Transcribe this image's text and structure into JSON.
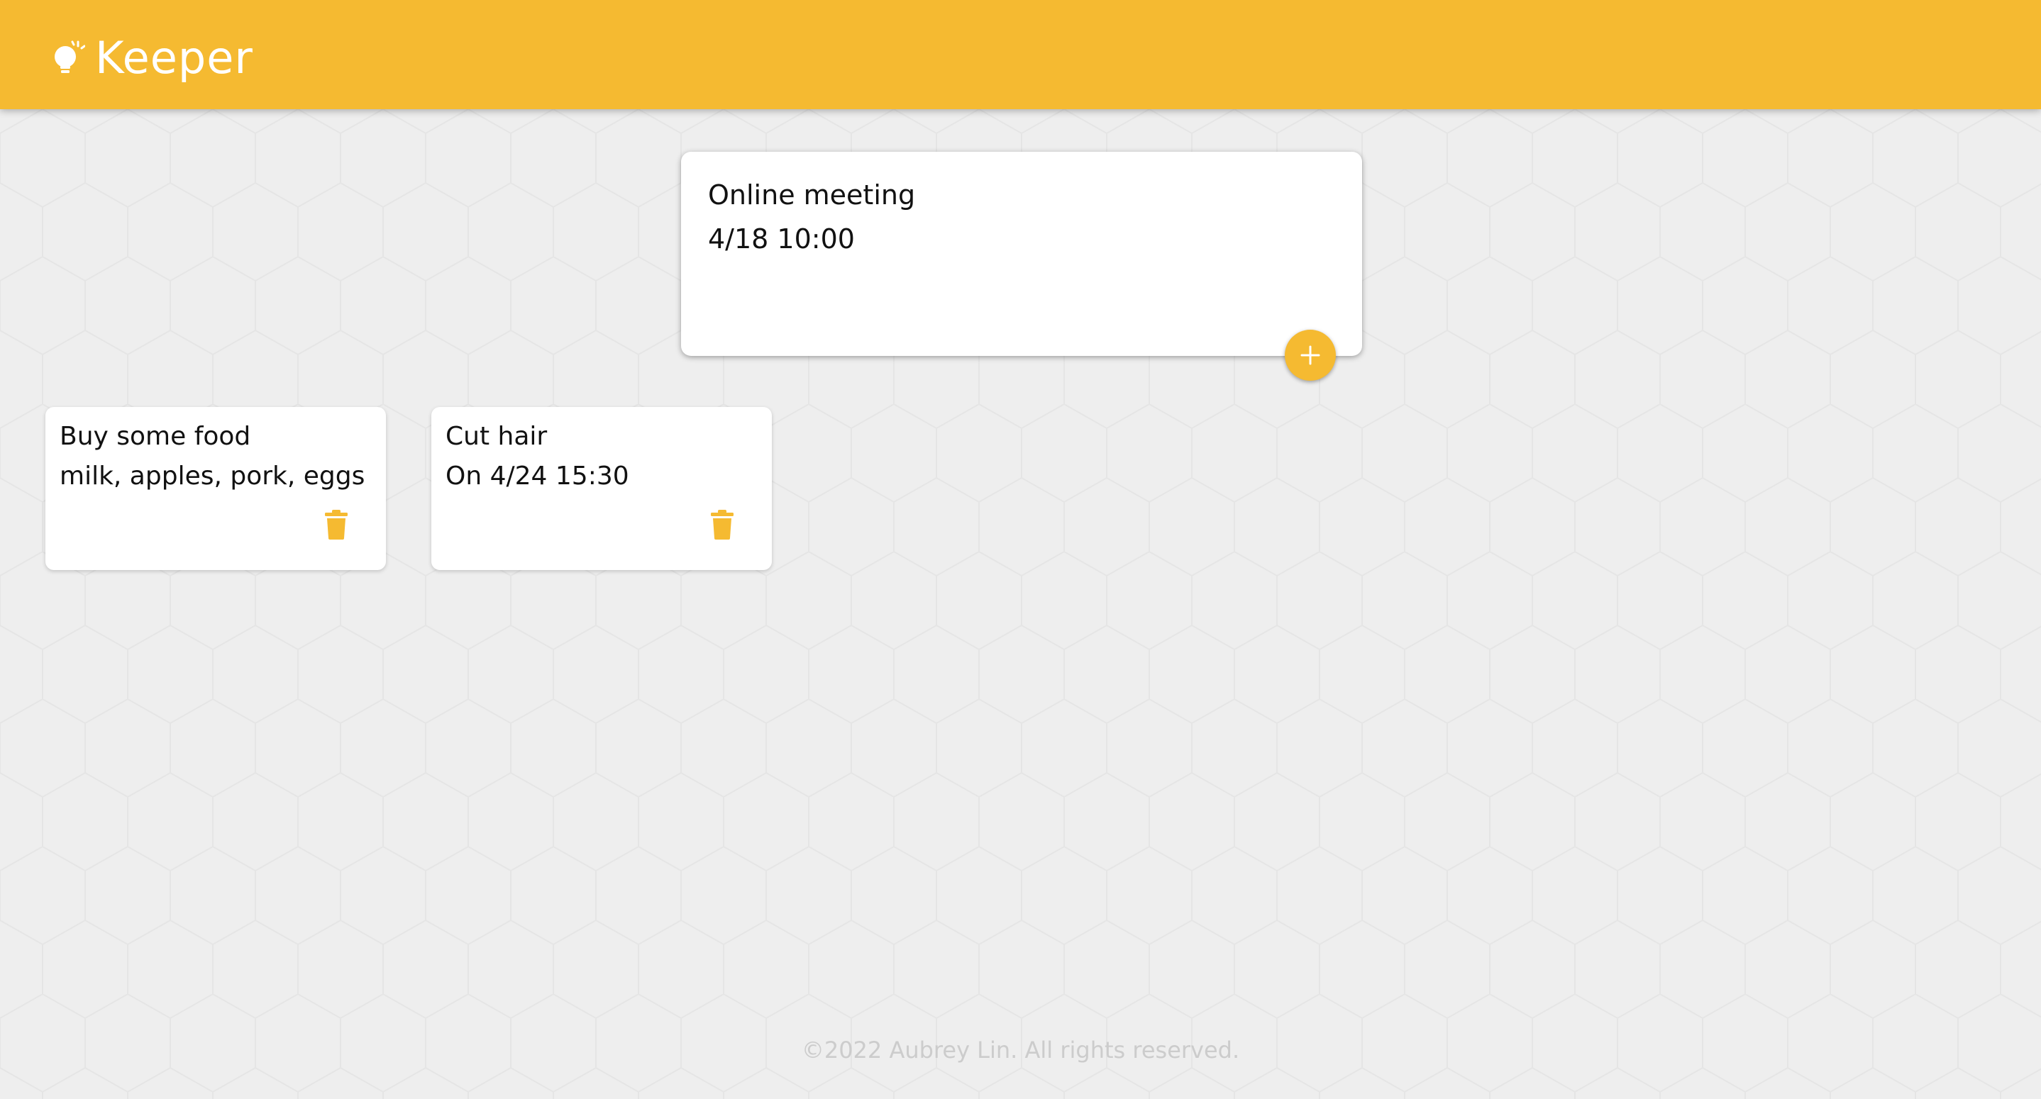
{
  "app": {
    "name": "Keeper",
    "accent_color": "#f5ba31",
    "background_color": "#eeeeee",
    "logo_icon": "lightbulb-icon"
  },
  "create_area": {
    "title": "Online meeting",
    "content": "4/18 10:00",
    "add_icon": "plus-icon"
  },
  "notes": [
    {
      "title": "Buy some food",
      "content": "milk, apples, pork, eggs",
      "delete_icon": "trash-icon"
    },
    {
      "title": "Cut hair",
      "content": "On 4/24 15:30",
      "delete_icon": "trash-icon"
    }
  ],
  "footer": {
    "copyright": "©2022 Aubrey Lin. All rights reserved."
  }
}
